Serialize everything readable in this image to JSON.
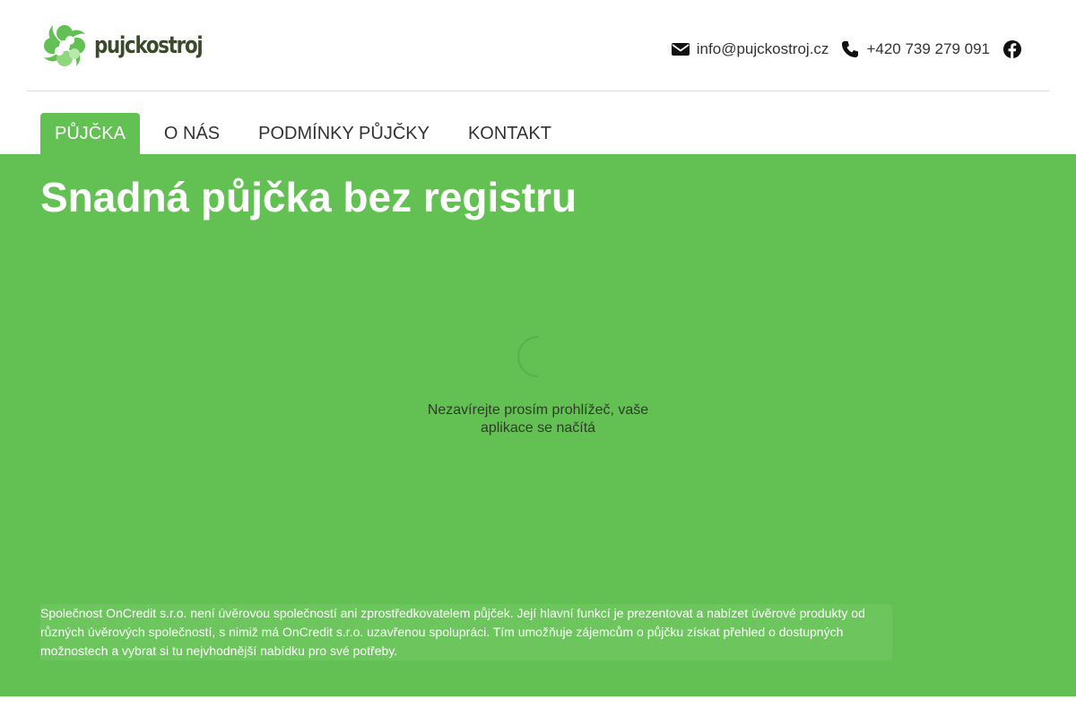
{
  "brand": {
    "name": "pujckostroj",
    "primary_color": "#63c052",
    "dark_color": "#3b4a2a"
  },
  "header": {
    "email": {
      "icon": "envelope-icon",
      "text": "info@pujckostroj.cz"
    },
    "phone": {
      "icon": "phone-icon",
      "text": "+420 739 279 091"
    },
    "social": {
      "icon": "facebook-icon"
    }
  },
  "nav": {
    "items": [
      {
        "label": "PŮJČKA",
        "active": true
      },
      {
        "label": "O NÁS",
        "active": false
      },
      {
        "label": "PODMÍNKY PŮJČKY",
        "active": false
      },
      {
        "label": "KONTAKT",
        "active": false
      }
    ]
  },
  "hero": {
    "title": "Snadná půjčka bez registru",
    "loading_line1": "Nezavírejte prosím prohlížeč, vaše",
    "loading_line2": "aplikace se načítá",
    "disclaimer": "Společnost OnCredit s.r.o. není úvěrovou společností ani zprostředkovatelem půjček. Její hlavní funkcí je prezentovat a nabízet úvěrové produkty od různých úvěrových společností, s nimiž má OnCredit s.r.o. uzavřenou spolupráci. Tím umožňuje zájemcům o půjčku získat přehled o dostupných možnostech a vybrat si tu nejvhodnější nabídku pro své potřeby."
  }
}
